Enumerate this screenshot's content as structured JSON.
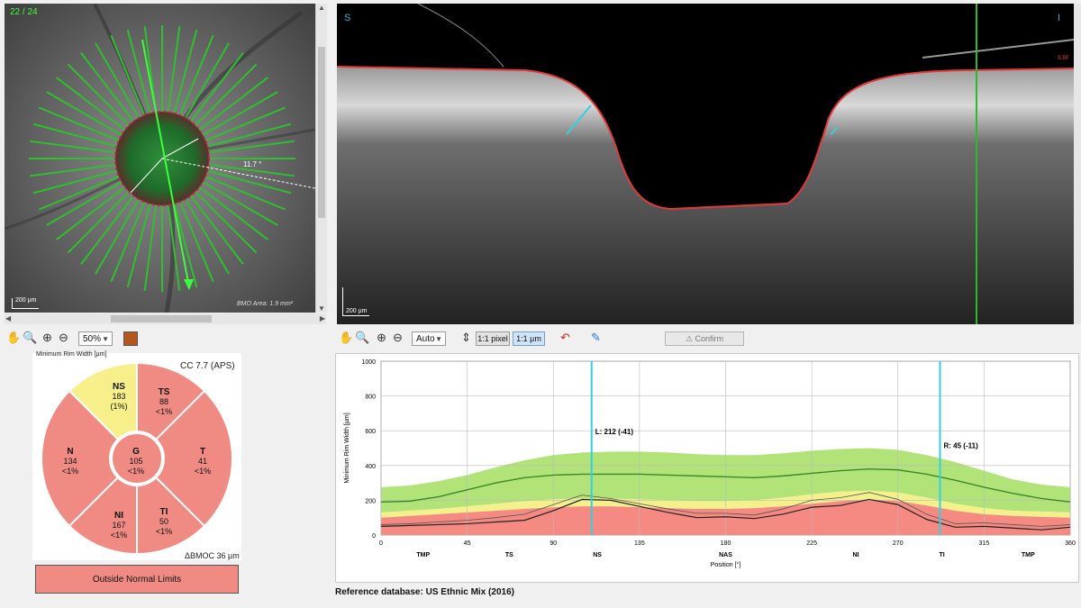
{
  "fundus": {
    "frame_counter": "22 / 24",
    "scale_bar_label": "200 µm",
    "angle_label": "11.7 °",
    "bmo_area_label": "BMO Area: 1.9 mm²"
  },
  "oct": {
    "left_orientation": "S",
    "right_orientation": "I",
    "ilm_label": "ILM",
    "scale_bar_label": "200 µm"
  },
  "left_toolbar": {
    "hand_icon": "hand-icon",
    "zoom_icon": "zoom-icon",
    "zoom_in_icon": "zoom-in-icon",
    "zoom_out_icon": "zoom-out-icon",
    "zoom_value": "50%",
    "color_icon": "color-swatch-icon"
  },
  "right_toolbar": {
    "zoom_value": "Auto",
    "pixel_button": "1:1 pixel",
    "micron_button": "1:1 µm",
    "confirm_button": "Confirm"
  },
  "mrw": {
    "title": "Minimum Rim Width [µm]",
    "cc_label": "CC 7.7 (APS)",
    "bmo_label": "ΔBMOC 36 µm",
    "status": "Outside Normal Limits",
    "sectors": [
      {
        "name": "NS",
        "value": "183",
        "pct": "(1%)"
      },
      {
        "name": "TS",
        "value": "88",
        "pct": "<1%"
      },
      {
        "name": "N",
        "value": "134",
        "pct": "<1%"
      },
      {
        "name": "G",
        "value": "105",
        "pct": "<1%"
      },
      {
        "name": "T",
        "value": "41",
        "pct": "<1%"
      },
      {
        "name": "NI",
        "value": "167",
        "pct": "<1%"
      },
      {
        "name": "TI",
        "value": "50",
        "pct": "<1%"
      }
    ],
    "colors": {
      "abnormal": "#f08b84",
      "borderline": "#f7f08a",
      "normal": "#8bd96b"
    }
  },
  "chart_data": {
    "type": "line",
    "ylabel": "Minimum Rim Width [µm]",
    "xlabel": "Position [°]",
    "xlim": [
      0,
      360
    ],
    "ylim": [
      0,
      1000
    ],
    "xticks": [
      0,
      45,
      90,
      135,
      180,
      225,
      270,
      315,
      360
    ],
    "yticks": [
      0,
      200,
      400,
      600,
      800,
      1000
    ],
    "sector_labels": [
      {
        "label": "TMP",
        "x": 22
      },
      {
        "label": "TS",
        "x": 67
      },
      {
        "label": "NS",
        "x": 113
      },
      {
        "label": "NAS",
        "x": 180
      },
      {
        "label": "NI",
        "x": 248
      },
      {
        "label": "TI",
        "x": 293
      },
      {
        "label": "TMP",
        "x": 338
      }
    ],
    "markers": [
      {
        "label": "L: 212 (-41)",
        "x": 110
      },
      {
        "label": "R: 45 (-11)",
        "x": 292
      }
    ],
    "x": [
      0,
      15,
      30,
      45,
      60,
      75,
      90,
      105,
      120,
      135,
      150,
      165,
      180,
      195,
      210,
      225,
      240,
      255,
      270,
      285,
      300,
      315,
      330,
      345,
      360
    ],
    "bands": {
      "red_upper": [
        100,
        110,
        120,
        130,
        140,
        150,
        160,
        165,
        165,
        160,
        155,
        150,
        150,
        155,
        165,
        180,
        195,
        205,
        195,
        170,
        140,
        120,
        110,
        105,
        100
      ],
      "yellow_upper": [
        130,
        140,
        150,
        165,
        180,
        195,
        205,
        210,
        210,
        205,
        200,
        195,
        195,
        200,
        215,
        235,
        250,
        255,
        245,
        215,
        180,
        155,
        140,
        135,
        130
      ],
      "green_upper": [
        275,
        285,
        310,
        345,
        390,
        430,
        460,
        475,
        480,
        480,
        475,
        465,
        460,
        460,
        470,
        485,
        495,
        500,
        490,
        460,
        420,
        370,
        320,
        290,
        275
      ]
    },
    "series": [
      {
        "name": "Normal",
        "values": [
          190,
          195,
          220,
          260,
          300,
          330,
          345,
          350,
          350,
          350,
          345,
          340,
          335,
          330,
          340,
          355,
          370,
          380,
          375,
          350,
          315,
          275,
          240,
          210,
          190
        ]
      },
      {
        "name": "Patient",
        "values": [
          50,
          55,
          60,
          65,
          75,
          85,
          140,
          205,
          200,
          165,
          130,
          100,
          105,
          95,
          120,
          160,
          170,
          205,
          175,
          90,
          45,
          50,
          40,
          30,
          45
        ]
      },
      {
        "name": "Previous",
        "values": [
          60,
          65,
          75,
          85,
          100,
          120,
          175,
          230,
          210,
          180,
          150,
          125,
          125,
          115,
          150,
          200,
          215,
          245,
          205,
          120,
          65,
          70,
          60,
          50,
          60
        ]
      }
    ],
    "colors": {
      "normal_line": "#3a8a2a",
      "patient_line": "#222222",
      "previous_line": "#555555",
      "marker": "#35d0e0"
    },
    "grid": true
  },
  "footer": {
    "reference_label": "Reference database: US Ethnic Mix (2016)"
  }
}
